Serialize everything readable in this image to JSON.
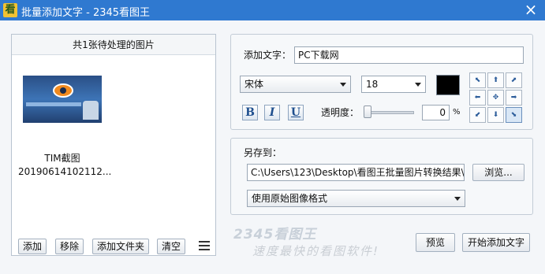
{
  "window": {
    "title": "批量添加文字 - 2345看图王",
    "app_icon_glyph": "看",
    "close_glyph": "×"
  },
  "left_panel": {
    "header": "共1张待处理的图片",
    "items": [
      {
        "name_line1": "TIM截图",
        "name_line2": "20190614102112..."
      }
    ],
    "buttons": {
      "add": "添加",
      "remove": "移除",
      "add_folder": "添加文件夹",
      "clear": "清空"
    }
  },
  "text_settings": {
    "add_text_label": "添加文字：",
    "add_text_value": "PC下载网",
    "font": "宋体",
    "size": "18",
    "color": "#000000",
    "bold_label": "B",
    "italic_label": "I",
    "underline_label": "U",
    "opacity_label": "透明度：",
    "opacity_value": "0",
    "opacity_unit": "%",
    "position_grid_glyphs": [
      "⬉",
      "⬆",
      "⬈",
      "⬅",
      "✥",
      "➡",
      "⬋",
      "⬇",
      "⬊"
    ],
    "position_selected_index": 8
  },
  "save_settings": {
    "save_to_label": "另存到：",
    "path": "C:\\Users\\123\\Desktop\\看图王批量图片转换结果\\",
    "browse_label": "浏览...",
    "format": "使用原始图像格式"
  },
  "footer": {
    "preview_label": "预览",
    "start_label": "开始添加文字",
    "brand": "2345看图王",
    "slogan": "速度最快的看图软件!"
  },
  "colors": {
    "titlebar": "#2f79d0",
    "font_color": "#000000"
  }
}
